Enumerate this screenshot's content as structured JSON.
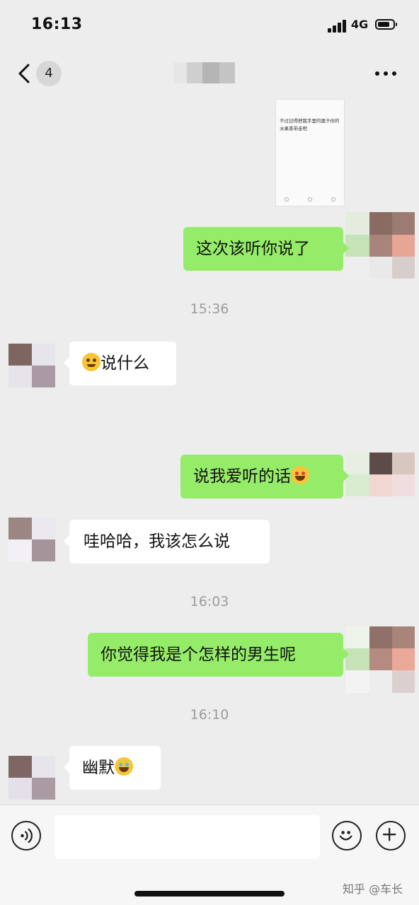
{
  "status_bar": {
    "time": "16:13",
    "network": "4G"
  },
  "nav": {
    "unread_count": "4",
    "contact_name_blurred": true
  },
  "chat": {
    "file_preview_text": "不过记得把我手里的属于你的水果茶带走吧",
    "messages": [
      {
        "side": "out",
        "text": "这次该听你说了"
      },
      {
        "timestamp": "15:36"
      },
      {
        "side": "in",
        "text": "说什么",
        "emoji": "facepalm-emoji"
      },
      {
        "side": "out",
        "text": "说我爱听的话",
        "emoji": "smiling-heart-eyes-emoji"
      },
      {
        "side": "in",
        "text": "哇哈哈，我该怎么说"
      },
      {
        "timestamp": "16:03"
      },
      {
        "side": "out",
        "text": "你觉得我是个怎样的男生呢"
      },
      {
        "timestamp": "16:10"
      },
      {
        "side": "in",
        "text": "幽默",
        "emoji": "tears-of-joy-emoji"
      }
    ],
    "ts_1536": "15:36",
    "ts_1603": "16:03",
    "ts_1610": "16:10",
    "msg1": "这次该听你说了",
    "msg2": "说什么",
    "msg3": "说我爱听的话",
    "msg4": "哇哈哈，我该怎么说",
    "msg5": "你觉得我是个怎样的男生呢",
    "msg6": "幽默"
  },
  "input_bar": {
    "value": ""
  },
  "watermark": "知乎 @车长",
  "colors": {
    "outgoing_bubble": "#95ec69",
    "incoming_bubble": "#ffffff",
    "background": "#ededed"
  }
}
